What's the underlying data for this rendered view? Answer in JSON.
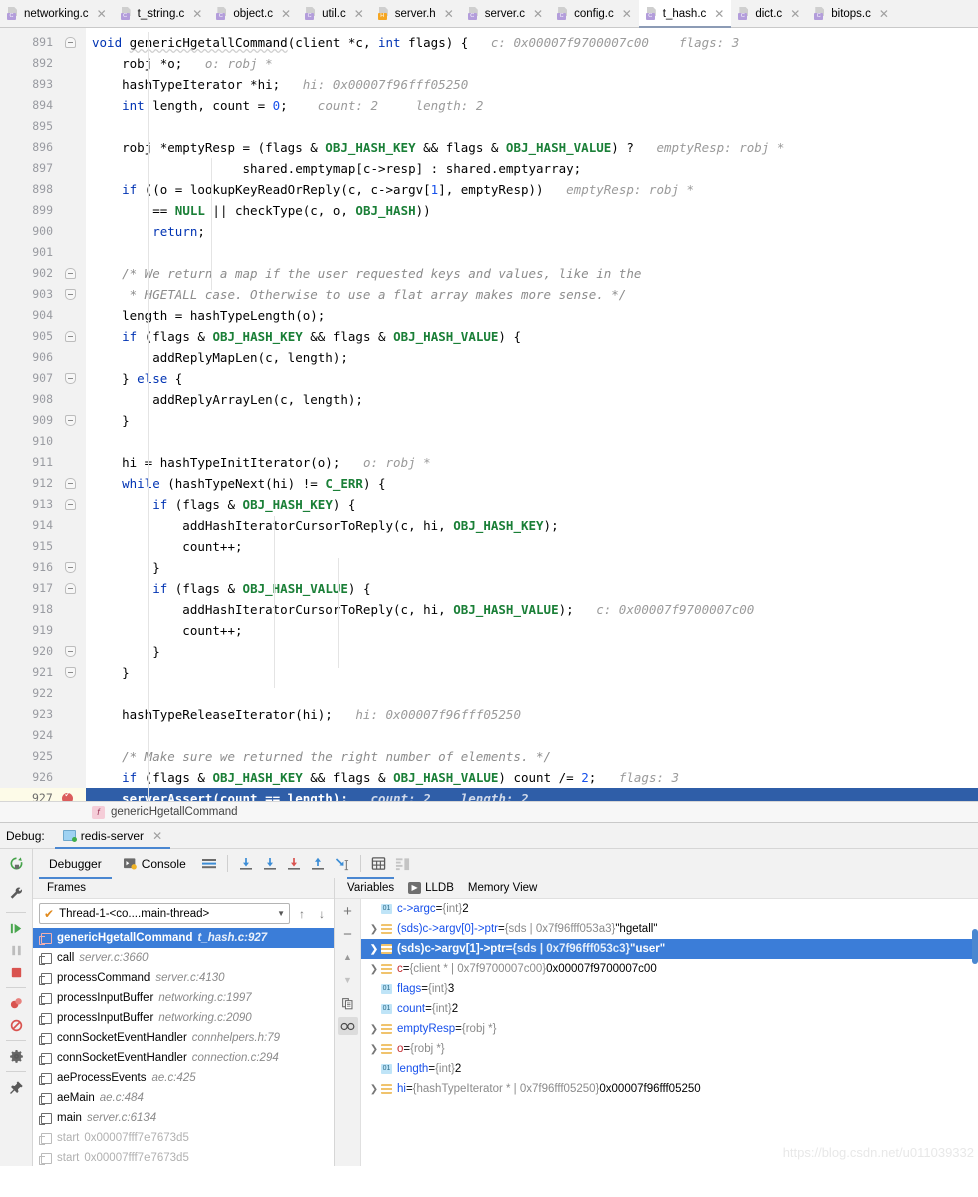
{
  "tabs": [
    {
      "label": "networking.c",
      "type": "c",
      "active": false
    },
    {
      "label": "t_string.c",
      "type": "c",
      "active": false
    },
    {
      "label": "object.c",
      "type": "c",
      "active": false
    },
    {
      "label": "util.c",
      "type": "c",
      "active": false
    },
    {
      "label": "server.h",
      "type": "h",
      "active": false
    },
    {
      "label": "server.c",
      "type": "c",
      "active": false
    },
    {
      "label": "config.c",
      "type": "c",
      "active": false
    },
    {
      "label": "t_hash.c",
      "type": "c",
      "active": true
    },
    {
      "label": "dict.c",
      "type": "c",
      "active": false
    },
    {
      "label": "bitops.c",
      "type": "c",
      "active": false
    }
  ],
  "tab_close_glyph": "✕",
  "editor": {
    "first_line": 891,
    "current_line": 927,
    "lines": [
      {
        "n": 891,
        "fold": "start",
        "segs": [
          {
            "t": "void ",
            "c": "kw"
          },
          {
            "t": "genericHgetallCommand",
            "c": "squig"
          },
          {
            "t": "(client *c, "
          },
          {
            "t": "int",
            "c": "kw"
          },
          {
            "t": " flags) {"
          },
          {
            "t": "   c: 0x00007f9700007c00    flags: 3",
            "c": "inlay"
          }
        ]
      },
      {
        "n": 892,
        "segs": [
          {
            "t": "    robj *o;   "
          },
          {
            "t": "o: robj *",
            "c": "inlay"
          }
        ]
      },
      {
        "n": 893,
        "segs": [
          {
            "t": "    hashTypeIterator *hi;   "
          },
          {
            "t": "hi: 0x00007f96fff05250",
            "c": "inlay"
          }
        ]
      },
      {
        "n": 894,
        "segs": [
          {
            "t": "    "
          },
          {
            "t": "int",
            "c": "kw"
          },
          {
            "t": " length, count = "
          },
          {
            "t": "0",
            "c": "num"
          },
          {
            "t": ";    "
          },
          {
            "t": "count: 2     length: 2",
            "c": "inlay"
          }
        ]
      },
      {
        "n": 895,
        "segs": [
          {
            "t": ""
          }
        ]
      },
      {
        "n": 896,
        "segs": [
          {
            "t": "    robj *emptyResp = (flags & "
          },
          {
            "t": "OBJ_HASH_KEY",
            "c": "const"
          },
          {
            "t": " && flags & "
          },
          {
            "t": "OBJ_HASH_VALUE",
            "c": "const"
          },
          {
            "t": ") ?   "
          },
          {
            "t": "emptyResp: robj *",
            "c": "inlay"
          }
        ]
      },
      {
        "n": 897,
        "segs": [
          {
            "t": "                    shared.emptymap[c->resp] : shared.emptyarray;"
          }
        ]
      },
      {
        "n": 898,
        "segs": [
          {
            "t": "    "
          },
          {
            "t": "if",
            "c": "kw"
          },
          {
            "t": " ((o = lookupKeyReadOrReply(c, c->argv["
          },
          {
            "t": "1",
            "c": "num"
          },
          {
            "t": "], emptyResp))   "
          },
          {
            "t": "emptyResp: robj *",
            "c": "inlay"
          }
        ]
      },
      {
        "n": 899,
        "segs": [
          {
            "t": "        == "
          },
          {
            "t": "NULL",
            "c": "const"
          },
          {
            "t": " || checkType(c, o, "
          },
          {
            "t": "OBJ_HASH",
            "c": "const"
          },
          {
            "t": "))"
          }
        ]
      },
      {
        "n": 900,
        "segs": [
          {
            "t": "        "
          },
          {
            "t": "return",
            "c": "kw"
          },
          {
            "t": ";"
          }
        ]
      },
      {
        "n": 901,
        "segs": [
          {
            "t": ""
          }
        ]
      },
      {
        "n": 902,
        "fold": "start",
        "segs": [
          {
            "t": "    /* We return a map if the user requested keys and values, like in the",
            "c": "cmtb"
          }
        ]
      },
      {
        "n": 903,
        "fold": "end",
        "segs": [
          {
            "t": "     * HGETALL case. Otherwise to use a flat array makes more sense. */",
            "c": "cmtb"
          }
        ]
      },
      {
        "n": 904,
        "segs": [
          {
            "t": "    length = hashTypeLength(o);"
          }
        ]
      },
      {
        "n": 905,
        "fold": "start",
        "segs": [
          {
            "t": "    "
          },
          {
            "t": "if",
            "c": "kw"
          },
          {
            "t": " (flags & "
          },
          {
            "t": "OBJ_HASH_KEY",
            "c": "const"
          },
          {
            "t": " && flags & "
          },
          {
            "t": "OBJ_HASH_VALUE",
            "c": "const"
          },
          {
            "t": ") {"
          }
        ]
      },
      {
        "n": 906,
        "segs": [
          {
            "t": "        addReplyMapLen(c, length);"
          }
        ]
      },
      {
        "n": 907,
        "fold": "end",
        "segs": [
          {
            "t": "    } "
          },
          {
            "t": "else",
            "c": "kw"
          },
          {
            "t": " {"
          }
        ]
      },
      {
        "n": 908,
        "segs": [
          {
            "t": "        addReplyArrayLen(c, length);"
          }
        ]
      },
      {
        "n": 909,
        "fold": "end",
        "segs": [
          {
            "t": "    }"
          }
        ]
      },
      {
        "n": 910,
        "segs": [
          {
            "t": ""
          }
        ]
      },
      {
        "n": 911,
        "segs": [
          {
            "t": "    hi = hashTypeInitIterator(o);   "
          },
          {
            "t": "o: robj *",
            "c": "inlay"
          }
        ]
      },
      {
        "n": 912,
        "fold": "start",
        "segs": [
          {
            "t": "    "
          },
          {
            "t": "while",
            "c": "kw"
          },
          {
            "t": " (hashTypeNext(hi) != "
          },
          {
            "t": "C_ERR",
            "c": "const"
          },
          {
            "t": ") {"
          }
        ]
      },
      {
        "n": 913,
        "fold": "start",
        "segs": [
          {
            "t": "        "
          },
          {
            "t": "if",
            "c": "kw"
          },
          {
            "t": " (flags & "
          },
          {
            "t": "OBJ_HASH_KEY",
            "c": "const"
          },
          {
            "t": ") {"
          }
        ]
      },
      {
        "n": 914,
        "segs": [
          {
            "t": "            addHashIteratorCursorToReply(c, hi, "
          },
          {
            "t": "OBJ_HASH_KEY",
            "c": "const"
          },
          {
            "t": ");"
          }
        ]
      },
      {
        "n": 915,
        "segs": [
          {
            "t": "            count++;"
          }
        ]
      },
      {
        "n": 916,
        "fold": "end",
        "segs": [
          {
            "t": "        }"
          }
        ]
      },
      {
        "n": 917,
        "fold": "start",
        "segs": [
          {
            "t": "        "
          },
          {
            "t": "if",
            "c": "kw"
          },
          {
            "t": " (flags & "
          },
          {
            "t": "OBJ_HASH_VALUE",
            "c": "const"
          },
          {
            "t": ") {"
          }
        ]
      },
      {
        "n": 918,
        "segs": [
          {
            "t": "            addHashIteratorCursorToReply(c, hi, "
          },
          {
            "t": "OBJ_HASH_VALUE",
            "c": "const"
          },
          {
            "t": ");   "
          },
          {
            "t": "c: 0x00007f9700007c00",
            "c": "inlay"
          }
        ]
      },
      {
        "n": 919,
        "segs": [
          {
            "t": "            count++;"
          }
        ]
      },
      {
        "n": 920,
        "fold": "end",
        "segs": [
          {
            "t": "        }"
          }
        ]
      },
      {
        "n": 921,
        "fold": "end",
        "segs": [
          {
            "t": "    }"
          }
        ]
      },
      {
        "n": 922,
        "segs": [
          {
            "t": ""
          }
        ]
      },
      {
        "n": 923,
        "segs": [
          {
            "t": "    hashTypeReleaseIterator(hi);   "
          },
          {
            "t": "hi: 0x00007f96fff05250",
            "c": "inlay"
          }
        ]
      },
      {
        "n": 924,
        "segs": [
          {
            "t": ""
          }
        ]
      },
      {
        "n": 925,
        "segs": [
          {
            "t": "    /* Make sure we returned the right number of elements. */",
            "c": "cmtb"
          }
        ]
      },
      {
        "n": 926,
        "segs": [
          {
            "t": "    "
          },
          {
            "t": "if",
            "c": "kw"
          },
          {
            "t": " (flags & "
          },
          {
            "t": "OBJ_HASH_KEY",
            "c": "const"
          },
          {
            "t": " && flags & "
          },
          {
            "t": "OBJ_HASH_VALUE",
            "c": "const"
          },
          {
            "t": ") count /= "
          },
          {
            "t": "2",
            "c": "num"
          },
          {
            "t": ";   "
          },
          {
            "t": "flags: 3",
            "c": "inlay"
          }
        ]
      },
      {
        "n": 927,
        "current": true,
        "segs": [
          {
            "t": "    serverAssert(count == length);   "
          },
          {
            "t": "count: 2    length: 2",
            "c": "cmt"
          }
        ]
      }
    ]
  },
  "breadcrumb": {
    "icon": "function-icon",
    "icon_glyph": "f",
    "label": "genericHgetallCommand"
  },
  "debug_window": {
    "label": "Debug:",
    "config_name": "redis-server",
    "close_glyph": "✕",
    "tabs": [
      {
        "label": "Debugger",
        "selected": true
      },
      {
        "label": "Console",
        "selected": false
      }
    ],
    "toolbar_icons": [
      "rerun-icon",
      "settings-wrench-icon",
      "resume-program-icon",
      "pause-program-icon",
      "stop-program-icon",
      "view-breakpoints-icon",
      "mute-breakpoints-icon",
      "settings-gear-icon",
      "pin-tab-icon"
    ],
    "step_icons": [
      "show-execution-point-icon",
      "step-over-icon",
      "step-into-icon",
      "force-step-into-icon",
      "step-out-icon",
      "run-to-cursor-icon",
      "evaluate-expression-icon",
      "layout-settings-icon"
    ]
  },
  "frames": {
    "header": "Frames",
    "thread": {
      "status_glyph": "✔",
      "label": "Thread-1-<co....main-thread>",
      "caret_glyph": "▼"
    },
    "nav": {
      "up_glyph": "↑",
      "down_glyph": "↓"
    },
    "items": [
      {
        "name": "genericHgetallCommand",
        "loc": "t_hash.c:927",
        "selected": true,
        "dim": false
      },
      {
        "name": "call",
        "loc": "server.c:3660",
        "selected": false,
        "dim": false
      },
      {
        "name": "processCommand",
        "loc": "server.c:4130",
        "selected": false,
        "dim": false
      },
      {
        "name": "processInputBuffer",
        "loc": "networking.c:1997",
        "selected": false,
        "dim": false
      },
      {
        "name": "processInputBuffer",
        "loc": "networking.c:2090",
        "selected": false,
        "dim": false
      },
      {
        "name": "connSocketEventHandler",
        "loc": "connhelpers.h:79",
        "selected": false,
        "dim": false
      },
      {
        "name": "connSocketEventHandler",
        "loc": "connection.c:294",
        "selected": false,
        "dim": false
      },
      {
        "name": "aeProcessEvents",
        "loc": "ae.c:425",
        "selected": false,
        "dim": false
      },
      {
        "name": "aeMain",
        "loc": "ae.c:484",
        "selected": false,
        "dim": false
      },
      {
        "name": "main",
        "loc": "server.c:6134",
        "selected": false,
        "dim": false
      },
      {
        "name": "start",
        "loc": "0x00007fff7e7673d5",
        "selected": false,
        "dim": true
      },
      {
        "name": "start",
        "loc": "0x00007fff7e7673d5",
        "selected": false,
        "dim": true
      }
    ]
  },
  "variables": {
    "tabs": [
      {
        "label": "Variables",
        "selected": true,
        "icon": null
      },
      {
        "label": "LLDB",
        "selected": false,
        "icon": "lldb-icon"
      },
      {
        "label": "Memory View",
        "selected": false,
        "icon": null
      }
    ],
    "side_buttons": [
      "add-watch-icon",
      "remove-watch-icon",
      "move-up-icon",
      "move-down-icon",
      "copy-value-icon",
      "inspect-icon"
    ],
    "side_glyphs": {
      "add": "+",
      "remove": "−",
      "up": "▲",
      "down": "▼"
    },
    "rows": [
      {
        "expandable": false,
        "kind": "prim",
        "name": "c->argc",
        "type": "{int}",
        "value": "2",
        "selected": false
      },
      {
        "expandable": true,
        "kind": "obj",
        "name": "(sds)c->argv[0]->ptr",
        "type": "{sds | 0x7f96fff053a3}",
        "value": "\"hgetall\"",
        "selected": false
      },
      {
        "expandable": true,
        "kind": "obj",
        "name": "(sds)c->argv[1]->ptr",
        "type": "{sds | 0x7f96fff053c3}",
        "value": "\"user\"",
        "selected": true
      },
      {
        "expandable": true,
        "kind": "obj",
        "name": "c",
        "name_color": "red",
        "type": "{client * | 0x7f9700007c00}",
        "value": "0x00007f9700007c00",
        "selected": false
      },
      {
        "expandable": false,
        "kind": "prim",
        "name": "flags",
        "type": "{int}",
        "value": "3",
        "selected": false
      },
      {
        "expandable": false,
        "kind": "prim",
        "name": "count",
        "type": "{int}",
        "value": "2",
        "selected": false
      },
      {
        "expandable": true,
        "kind": "obj",
        "name": "emptyResp",
        "type": "{robj *}",
        "value": "",
        "selected": false
      },
      {
        "expandable": true,
        "kind": "obj",
        "name": "o",
        "name_color": "red",
        "type": "{robj *}",
        "value": "",
        "selected": false
      },
      {
        "expandable": false,
        "kind": "prim",
        "name": "length",
        "type": "{int}",
        "value": "2",
        "selected": false
      },
      {
        "expandable": true,
        "kind": "obj",
        "name": "hi",
        "type": "{hashTypeIterator * | 0x7f96fff05250}",
        "value": "0x00007f96fff05250",
        "selected": false
      }
    ]
  },
  "watermark": "https://blog.csdn.net/u011039332"
}
